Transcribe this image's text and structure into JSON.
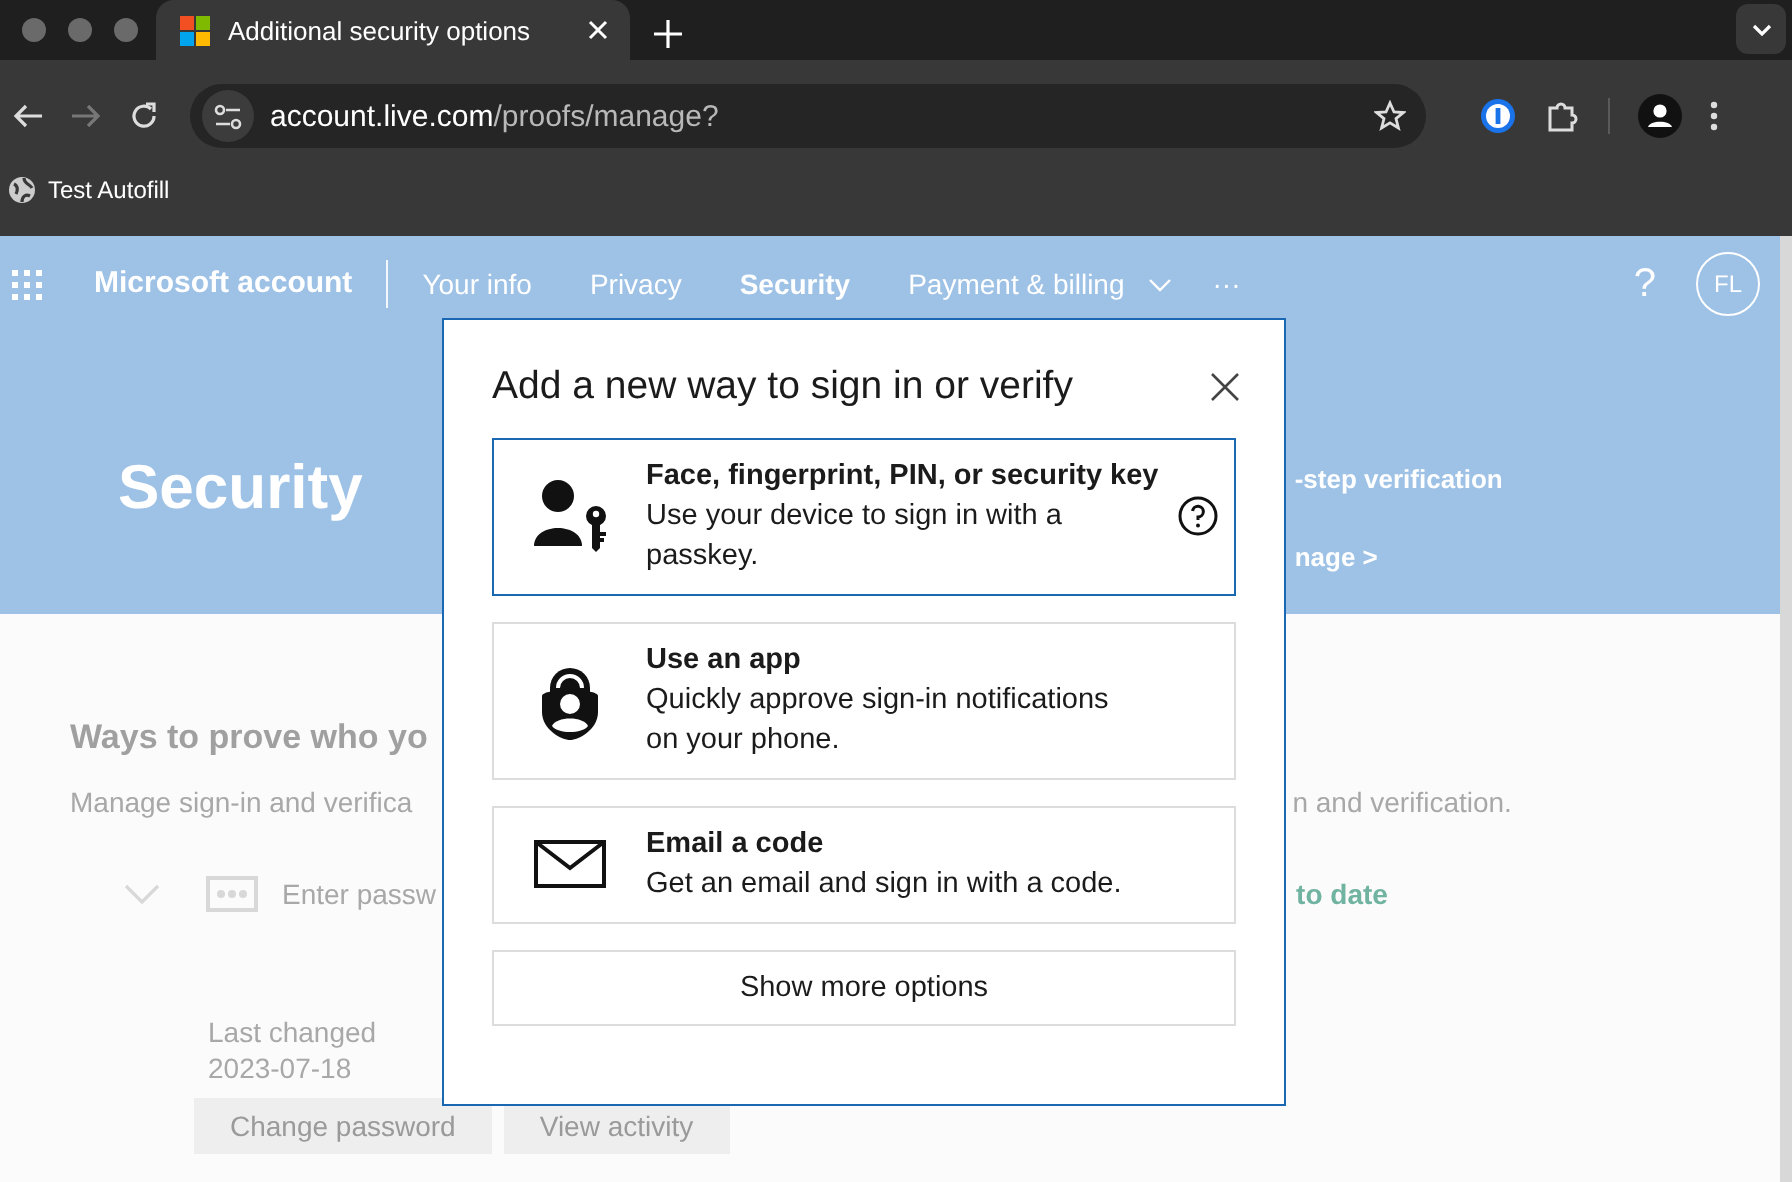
{
  "browser": {
    "tab": {
      "title": "Additional security options",
      "selected": true
    },
    "address": {
      "host": "account.live.com",
      "path": "/proofs/manage?"
    },
    "bookmarks": [
      "Test Autofill"
    ]
  },
  "site_header": {
    "brand": "Microsoft account",
    "nav": [
      {
        "label": "Your info",
        "selected": false
      },
      {
        "label": "Privacy",
        "selected": false
      },
      {
        "label": "Security",
        "selected": true
      },
      {
        "label": "Payment & billing",
        "selected": false
      }
    ],
    "more": "···",
    "help": "?",
    "avatar": "FL"
  },
  "hero": {
    "title": "Security",
    "side_title": "-step verification",
    "side_link": "nage >"
  },
  "section": {
    "heading": "Ways to prove who yo",
    "description_left": "Manage sign-in and verifica",
    "description_right": "n and verification.",
    "row": {
      "expanded": true,
      "label": "Enter passw",
      "status": "to date"
    },
    "details": {
      "label": "Last changed",
      "value": "2023-07-18"
    },
    "buttons": [
      "Change password",
      "View activity"
    ]
  },
  "dialog": {
    "title": "Add a new way to sign in or verify",
    "options": [
      {
        "kind": "passkey",
        "title": "Face, fingerprint, PIN, or security key",
        "description": "Use your device to sign in with a passkey.",
        "selected": true,
        "help": true
      },
      {
        "kind": "app",
        "title": "Use an app",
        "description": "Quickly approve sign-in notifications on your phone.",
        "selected": false,
        "help": false
      },
      {
        "kind": "email",
        "title": "Email a code",
        "description": "Get an email and sign in with a code.",
        "selected": false,
        "help": false
      }
    ],
    "more_button": "Show more options"
  }
}
